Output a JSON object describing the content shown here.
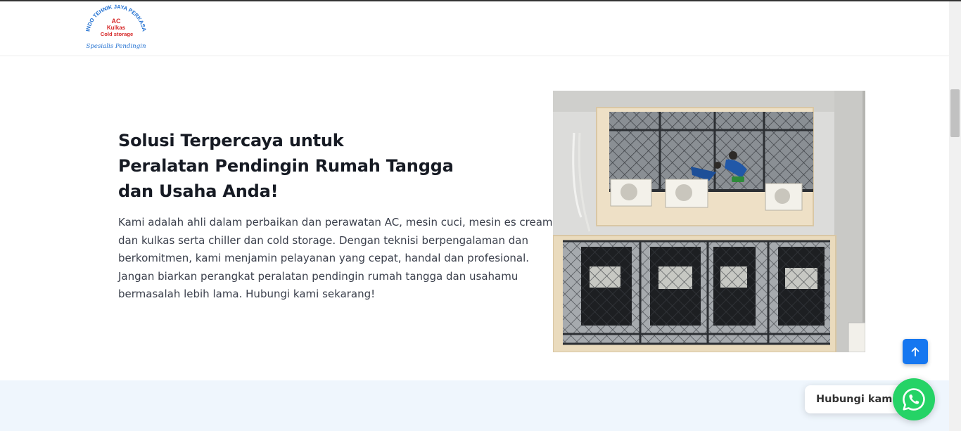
{
  "logo": {
    "arc_text": "INDO TEHNIK JAYA PERKASA",
    "line1": "AC",
    "line2": "Kulkas",
    "line3": "Cold storage",
    "tagline": "Spesialis Pendingin"
  },
  "hero": {
    "title_lines": [
      "Solusi Terpercaya untuk",
      "Peralatan Pendingin Rumah Tangga",
      "dan Usaha Anda!"
    ],
    "description_lines": [
      "Kami adalah ahli dalam perbaikan dan perawatan AC, mesin cuci, mesin es cream",
      "dan kulkas serta chiller dan cold storage. Dengan teknisi berpengalaman dan",
      "berkomitmen, kami menjamin pelayanan yang cepat, handal dan profesional.",
      "Jangan biarkan perangkat peralatan pendingin rumah tangga dan usahamu",
      "bermasalah lebih lama. Hubungi kami sekarang!"
    ],
    "image_icon": "technicians-servicing-ac-photo"
  },
  "floating": {
    "back_to_top_icon": "arrow-up-icon",
    "whatsapp_label": "Hubungi kami",
    "whatsapp_icon": "whatsapp-icon"
  },
  "colors": {
    "primary_blue": "#1677f0",
    "whatsapp_green": "#25d366",
    "section_bg": "#eff6fd",
    "title_text": "#161a23",
    "body_text": "#3a3f4b"
  }
}
